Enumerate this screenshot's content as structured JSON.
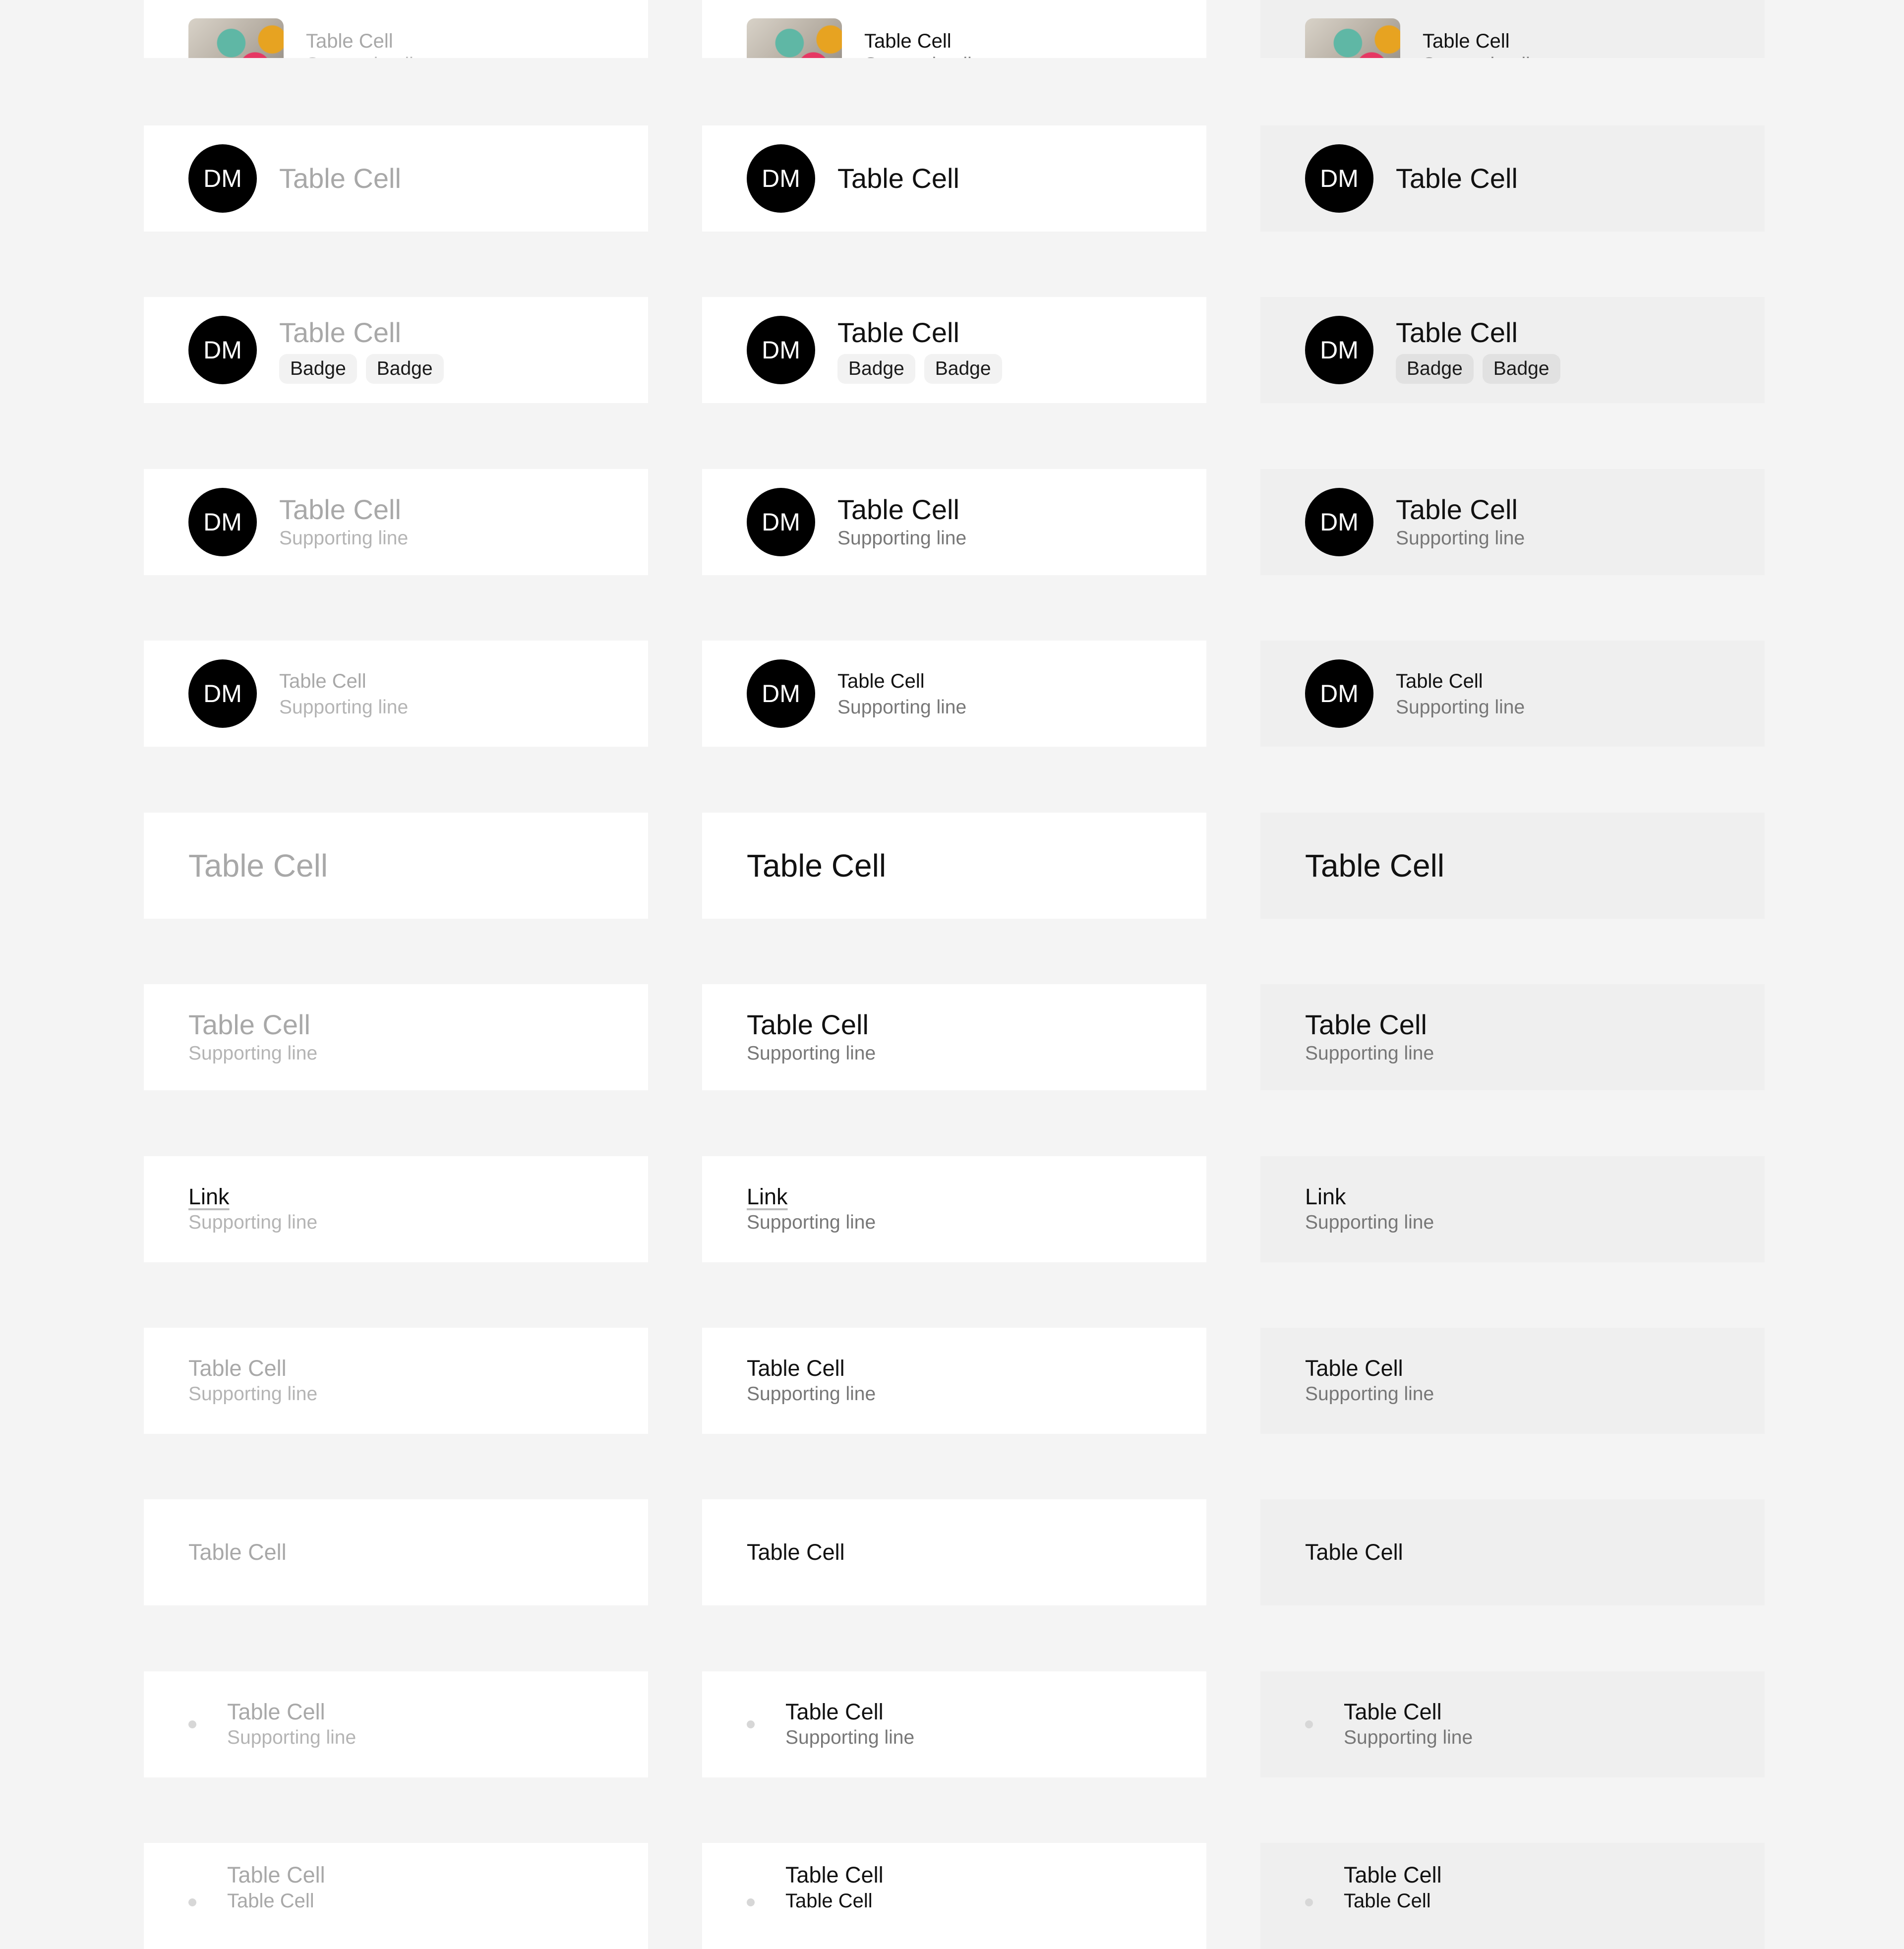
{
  "cell_title": "Table Cell",
  "supporting": "Supporting line",
  "badge": "Badge",
  "link": "Link",
  "avatar_initials": "DM",
  "colors": {
    "page_background": "#f4f4f4",
    "cell_default": "#ffffff",
    "cell_hovered": "#efefef",
    "avatar": "#000000",
    "text_primary": "#111111",
    "text_disabled": "#a8a8a8",
    "text_supporting": "#777777"
  },
  "columns": [
    "disabled",
    "default",
    "hovered"
  ]
}
